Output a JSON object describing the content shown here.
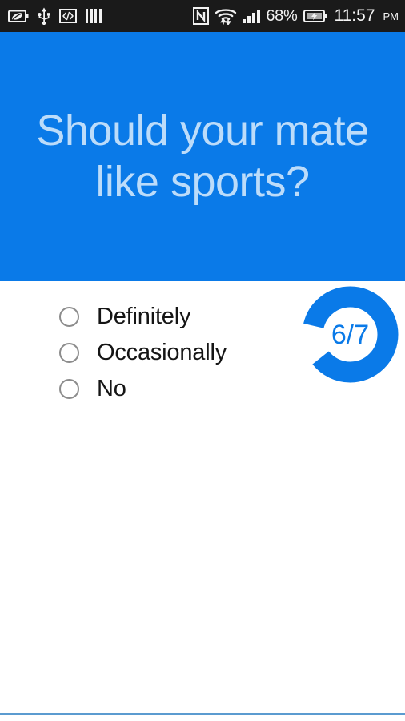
{
  "status_bar": {
    "icons_left": [
      {
        "name": "eco-battery-saver-icon",
        "glyph": "leaf-in-battery"
      },
      {
        "name": "usb-icon",
        "glyph": "usb"
      },
      {
        "name": "developer-options-icon",
        "glyph": "</>"
      },
      {
        "name": "vertical-bars-icon",
        "glyph": "bars"
      }
    ],
    "icons_right": [
      {
        "name": "nfc-icon",
        "glyph": "N"
      },
      {
        "name": "wifi-icon",
        "glyph": "wifi-updown"
      },
      {
        "name": "cellular-signal-icon",
        "glyph": "signal-4-bars"
      }
    ],
    "battery_percent": "68%",
    "battery_state": "charging",
    "time": "11:57",
    "time_period": "PM"
  },
  "header": {
    "question": "Should your mate like sports?",
    "background_color": "#0a7ae8",
    "text_color": "#bcdcfa"
  },
  "quiz": {
    "options": [
      {
        "label": "Definitely",
        "selected": false
      },
      {
        "label": "Occasionally",
        "selected": false
      },
      {
        "label": "No",
        "selected": false
      }
    ],
    "progress": {
      "current": 6,
      "total": 7,
      "display": "6/7",
      "ring_color": "#0a7ae8",
      "text_color": "#0a7ae8"
    }
  },
  "footer": {
    "divider_color": "#5b9bd0"
  }
}
